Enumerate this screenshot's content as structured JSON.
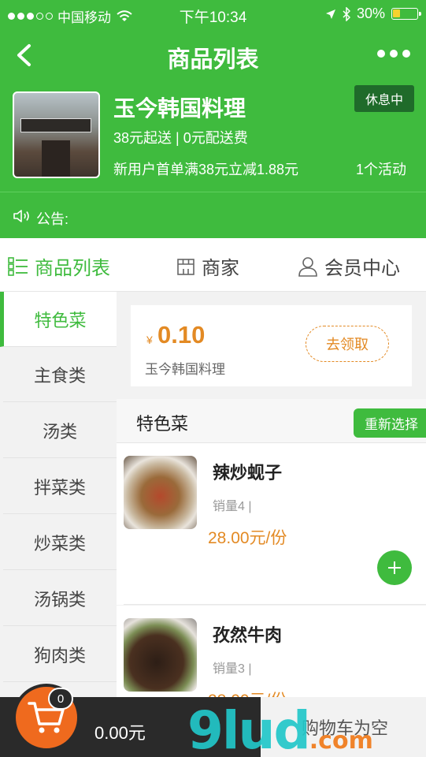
{
  "status_bar": {
    "carrier": "中国移动",
    "time": "下午10:34",
    "battery": "30%",
    "battery_level": 0.3
  },
  "nav": {
    "title": "商品列表",
    "back_icon": "chevron-left-icon",
    "more_icon": "more-dots-icon"
  },
  "shop": {
    "name": "玉今韩国料理",
    "status": "休息中",
    "delivery": "38元起送 | 0元配送费",
    "promotion": "新用户首单满38元立减1.88元",
    "activity": "1个活动"
  },
  "notice": {
    "label": "公告:"
  },
  "tabs": [
    {
      "label": "商品列表",
      "active": true
    },
    {
      "label": "商家",
      "active": false
    },
    {
      "label": "会员中心",
      "active": false
    }
  ],
  "categories": [
    "特色菜",
    "主食类",
    "汤类",
    "拌菜类",
    "炒菜类",
    "汤锅类",
    "狗肉类"
  ],
  "coupon": {
    "currency": "¥",
    "amount": "0.10",
    "shop": "玉今韩国料理",
    "claim_label": "去领取"
  },
  "section": {
    "title": "特色菜",
    "reselect_label": "重新选择"
  },
  "items": [
    {
      "name": "辣炒蚬子",
      "sales": "销量4 |",
      "price": "28.00元/份"
    },
    {
      "name": "孜然牛肉",
      "sales": "销量3 |",
      "price": "28.00元/份"
    }
  ],
  "cart": {
    "count": "0",
    "total": "0.00元",
    "empty_label": "购物车为空"
  },
  "watermark": {
    "text": "9lud",
    "suffix": ".com"
  },
  "colors": {
    "brand_green": "#3fbb3e",
    "price_orange": "#e38a24",
    "cart_orange": "#ef6a1e"
  }
}
